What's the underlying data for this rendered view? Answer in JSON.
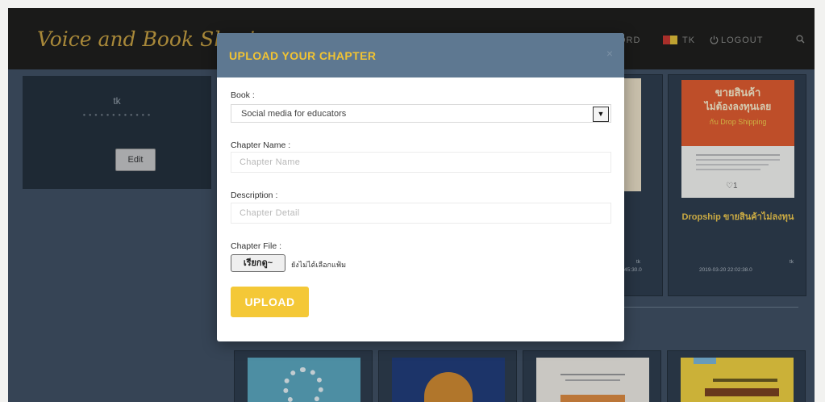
{
  "navbar": {
    "brand": "Voice and Book Sharing",
    "items": [
      "ORD",
      "TK",
      "LOGOUT"
    ],
    "search_icon": "search-icon",
    "user_flag_icon": "flag-icon",
    "logout_icon": "power-icon"
  },
  "profile": {
    "name": "tk",
    "edit_label": "Edit"
  },
  "book_cards": [
    {
      "title": "Dropship ขายสินค้าไม่ลงทุน",
      "cover_line1": "ขายสินค้า",
      "cover_line2": "ไม่ต้องลงทุนเลย",
      "cover_line3": "กับ Drop Shipping",
      "likes": "1",
      "owner": "tk",
      "date": "2019-03-20  22:02:38.0"
    },
    {
      "owner": "tk",
      "date": "22:45:30.0"
    }
  ],
  "modal": {
    "title": "UPLOAD YOUR CHAPTER",
    "close": "×",
    "book_label": "Book :",
    "book_value": "Social media for educators",
    "chapter_name_label": "Chapter Name :",
    "chapter_name_placeholder": "Chapter Name",
    "description_label": "Description :",
    "description_placeholder": "Chapter Detail",
    "chapter_file_label": "Chapter File :",
    "choose_file_label": "เรียกดู",
    "file_status": "ยังไม่ได้เลือกแฟ้ม",
    "upload_label": "UPLOAD"
  },
  "colors": {
    "accent": "#f4c837",
    "modal_header": "#5e7891",
    "navbar": "#1b1a17",
    "page_bg": "#3d4e60"
  }
}
